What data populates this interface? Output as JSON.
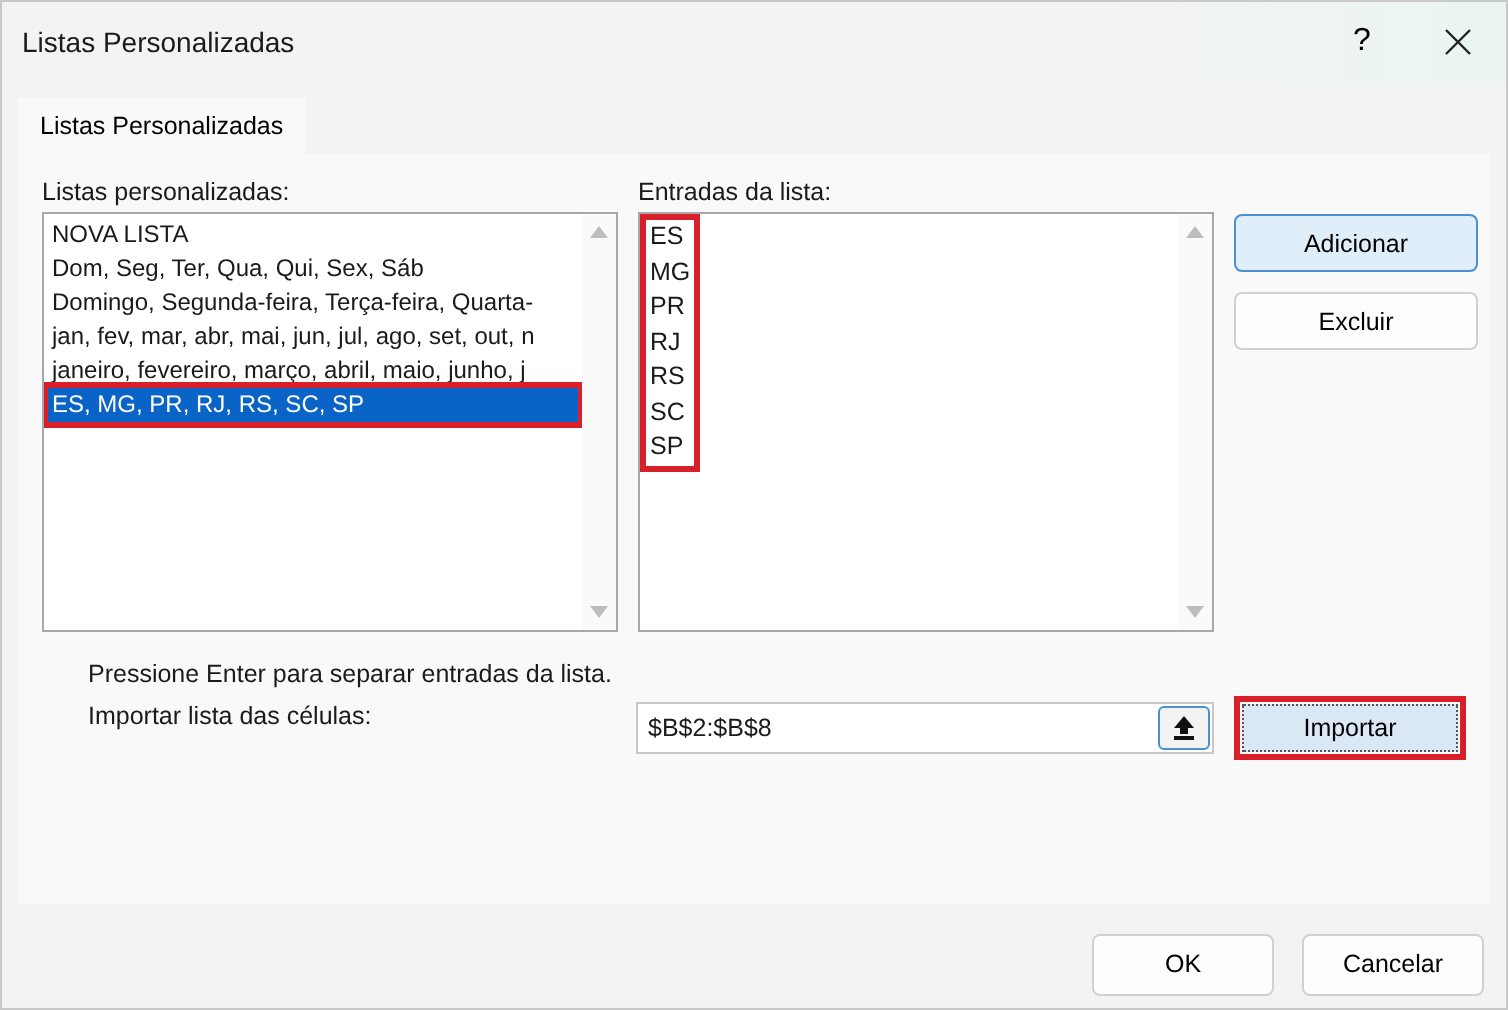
{
  "window": {
    "title": "Listas Personalizadas",
    "help": "?"
  },
  "tabs": [
    {
      "label": "Listas Personalizadas",
      "selected": true
    }
  ],
  "lists": {
    "label": "Listas personalizadas:",
    "items": [
      {
        "text": "NOVA LISTA",
        "selected": false,
        "highlighted": false
      },
      {
        "text": "Dom, Seg, Ter, Qua, Qui, Sex, Sáb",
        "selected": false,
        "highlighted": false
      },
      {
        "text": "Domingo, Segunda-feira, Terça-feira, Quarta-",
        "selected": false,
        "highlighted": false
      },
      {
        "text": "jan, fev, mar, abr, mai, jun, jul, ago, set, out, n",
        "selected": false,
        "highlighted": false
      },
      {
        "text": "janeiro, fevereiro, março, abril, maio, junho, j",
        "selected": false,
        "highlighted": false
      },
      {
        "text": "ES, MG, PR, RJ, RS, SC, SP",
        "selected": true,
        "highlighted": true
      }
    ]
  },
  "entries": {
    "label": "Entradas da lista:",
    "highlighted": true,
    "items": [
      "ES",
      "MG",
      "PR",
      "RJ",
      "RS",
      "SC",
      "SP"
    ]
  },
  "side_buttons": [
    {
      "label": "Adicionar",
      "default": true
    },
    {
      "label": "Excluir",
      "default": false
    }
  ],
  "hint": "Pressione Enter para separar entradas da lista.",
  "import": {
    "label": "Importar lista das células:",
    "value": "$B$2:$B$8",
    "button": "Importar",
    "highlighted": true
  },
  "footer_buttons": [
    "OK",
    "Cancelar"
  ]
}
